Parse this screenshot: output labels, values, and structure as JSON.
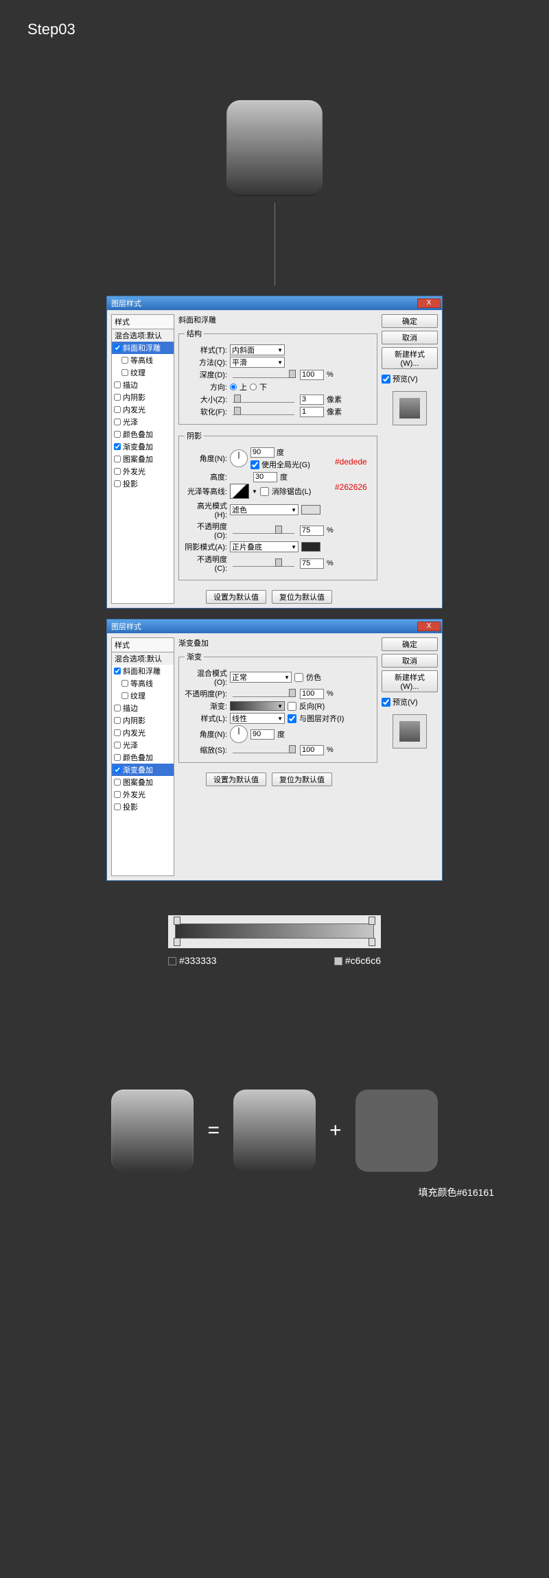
{
  "step_title": "Step03",
  "dialog_title": "图层样式",
  "close_label": "X",
  "styles_header": "样式",
  "blend_options": "混合选项:默认",
  "styles": {
    "bevel": "斜面和浮雕",
    "contour": "等高线",
    "texture": "纹理",
    "stroke": "描边",
    "inner_shadow": "内阴影",
    "inner_glow": "内发光",
    "satin": "光泽",
    "color_overlay": "颜色叠加",
    "gradient_overlay": "渐变叠加",
    "pattern_overlay": "图案叠加",
    "outer_glow": "外发光",
    "drop_shadow": "投影"
  },
  "bevel": {
    "section": "斜面和浮雕",
    "structure": "结构",
    "style_label": "样式(T):",
    "style_value": "内斜面",
    "technique_label": "方法(Q):",
    "technique_value": "平滑",
    "depth_label": "深度(D):",
    "depth_value": "100",
    "depth_unit": "%",
    "direction_label": "方向:",
    "dir_up": "上",
    "dir_down": "下",
    "size_label": "大小(Z):",
    "size_value": "3",
    "size_unit": "像素",
    "soften_label": "软化(F):",
    "soften_value": "1",
    "soften_unit": "像素",
    "shading": "阴影",
    "angle_label": "角度(N):",
    "angle_value": "90",
    "angle_unit": "度",
    "global_light": "使用全局光(G)",
    "altitude_label": "高度:",
    "altitude_value": "30",
    "altitude_unit": "度",
    "gloss_contour": "光泽等高线:",
    "antialias": "消除锯齿(L)",
    "highlight_mode": "高光模式(H):",
    "highlight_value": "滤色",
    "opacity1_label": "不透明度(O):",
    "opacity1_value": "75",
    "shadow_mode": "阴影模式(A):",
    "shadow_value": "正片叠底",
    "opacity2_label": "不透明度(C):",
    "opacity2_value": "75",
    "pct": "%",
    "annot_highlight": "#dedede",
    "annot_shadow": "#262626"
  },
  "gradov": {
    "section": "渐变叠加",
    "group": "渐变",
    "blend_label": "混合模式(O):",
    "blend_value": "正常",
    "dither": "仿色",
    "opacity_label": "不透明度(P):",
    "opacity_value": "100",
    "pct": "%",
    "gradient_label": "渐变:",
    "reverse": "反向(R)",
    "style_label": "样式(L):",
    "style_value": "线性",
    "align": "与图层对齐(I)",
    "angle_label": "角度(N):",
    "angle_value": "90",
    "angle_unit": "度",
    "scale_label": "缩放(S):",
    "scale_value": "100"
  },
  "buttons": {
    "set_default": "设置为默认值",
    "reset_default": "复位为默认值",
    "ok": "确定",
    "cancel": "取消",
    "new_style": "新建样式(W)...",
    "preview": "预览(V)"
  },
  "grad_colors": {
    "left": "#333333",
    "right": "#c6c6c6"
  },
  "equation": {
    "equals": "=",
    "plus": "+"
  },
  "fill_label": "填充颜色#616161"
}
